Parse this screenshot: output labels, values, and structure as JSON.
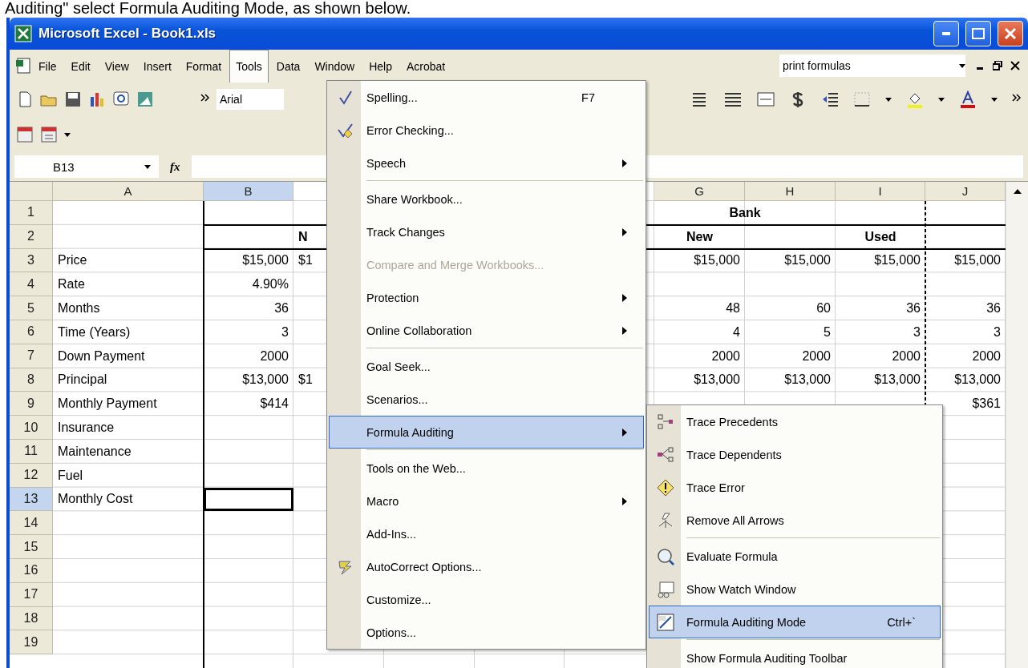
{
  "caption": "Auditing\" select Formula Auditing Mode, as shown below.",
  "window": {
    "title": "Microsoft Excel - Book1.xls"
  },
  "menubar": [
    {
      "label": "File",
      "selected": false
    },
    {
      "label": "Edit",
      "selected": false
    },
    {
      "label": "View",
      "selected": false
    },
    {
      "label": "Insert",
      "selected": false
    },
    {
      "label": "Format",
      "selected": false
    },
    {
      "label": "Tools",
      "selected": true
    },
    {
      "label": "Data",
      "selected": false
    },
    {
      "label": "Window",
      "selected": false
    },
    {
      "label": "Help",
      "selected": false
    },
    {
      "label": "Acrobat",
      "selected": false
    }
  ],
  "help_box": {
    "value": "print formulas"
  },
  "toolbar": {
    "font_field": {
      "value": "Arial"
    }
  },
  "formula_bar": {
    "name_box": "B13",
    "fx_label": "fx"
  },
  "columns": {
    "a": {
      "label": "A",
      "selected": false
    },
    "b": {
      "label": "B",
      "selected": true
    },
    "g": {
      "label": "G",
      "selected": false
    },
    "h": {
      "label": "H",
      "selected": false
    },
    "i": {
      "label": "I",
      "selected": false
    },
    "j": {
      "label": "J",
      "selected": false
    }
  },
  "rows": [
    {
      "header": "1",
      "selected": false,
      "kind": "heading",
      "cells": {
        "g": "Bank"
      }
    },
    {
      "header": "2",
      "selected": false,
      "kind": "heading",
      "cells": {
        "c": "N",
        "g": "New",
        "i": "Used"
      }
    },
    {
      "header": "3",
      "selected": false,
      "kind": "data",
      "cells": {
        "a": "Price",
        "b": "$15,000",
        "c": "$1",
        "g": "$15,000",
        "h": "$15,000",
        "i": "$15,000",
        "j": "$15,000"
      }
    },
    {
      "header": "4",
      "selected": false,
      "kind": "data",
      "cells": {
        "a": "Rate",
        "b": "4.90%"
      }
    },
    {
      "header": "5",
      "selected": false,
      "kind": "data",
      "cells": {
        "a": "Months",
        "b": "36",
        "g": "48",
        "h": "60",
        "i": "36",
        "j": "36"
      }
    },
    {
      "header": "6",
      "selected": false,
      "kind": "data",
      "cells": {
        "a": "Time (Years)",
        "b": "3",
        "g": "4",
        "h": "5",
        "i": "3",
        "j": "3"
      }
    },
    {
      "header": "7",
      "selected": false,
      "kind": "data",
      "cells": {
        "a": "Down Payment",
        "b": "2000",
        "g": "2000",
        "h": "2000",
        "i": "2000",
        "j": "2000"
      }
    },
    {
      "header": "8",
      "selected": false,
      "kind": "data",
      "cells": {
        "a": "Principal",
        "b": "$13,000",
        "c": "$1",
        "g": "$13,000",
        "h": "$13,000",
        "i": "$13,000",
        "j": "$13,000"
      }
    },
    {
      "header": "9",
      "selected": false,
      "kind": "data",
      "cells": {
        "a": "Monthly Payment",
        "b": "$414",
        "j": "$361"
      }
    },
    {
      "header": "10",
      "selected": false,
      "kind": "data",
      "cells": {
        "a": "Insurance"
      }
    },
    {
      "header": "11",
      "selected": false,
      "kind": "data",
      "cells": {
        "a": "Maintenance"
      }
    },
    {
      "header": "12",
      "selected": false,
      "kind": "data",
      "cells": {
        "a": "Fuel"
      }
    },
    {
      "header": "13",
      "selected": true,
      "kind": "data",
      "cells": {
        "a": "Monthly Cost"
      }
    },
    {
      "header": "14",
      "selected": false,
      "kind": "data",
      "cells": {}
    },
    {
      "header": "15",
      "selected": false,
      "kind": "data",
      "cells": {}
    },
    {
      "header": "16",
      "selected": false,
      "kind": "data",
      "cells": {}
    },
    {
      "header": "17",
      "selected": false,
      "kind": "data",
      "cells": {}
    },
    {
      "header": "18",
      "selected": false,
      "kind": "data",
      "cells": {}
    },
    {
      "header": "19",
      "selected": false,
      "kind": "data",
      "cells": {}
    }
  ],
  "tools_menu": [
    {
      "label": "Spelling...",
      "shortcut": "F7",
      "submenu": false,
      "disabled": false,
      "selected": false,
      "separator_before": false
    },
    {
      "label": "Error Checking...",
      "submenu": false,
      "disabled": false,
      "selected": false,
      "separator_before": false
    },
    {
      "label": "Speech",
      "submenu": true,
      "disabled": false,
      "selected": false,
      "separator_before": false
    },
    {
      "label": "Share Workbook...",
      "submenu": false,
      "disabled": false,
      "selected": false,
      "separator_before": true
    },
    {
      "label": "Track Changes",
      "submenu": true,
      "disabled": false,
      "selected": false,
      "separator_before": false
    },
    {
      "label": "Compare and Merge Workbooks...",
      "submenu": false,
      "disabled": true,
      "selected": false,
      "separator_before": false
    },
    {
      "label": "Protection",
      "submenu": true,
      "disabled": false,
      "selected": false,
      "separator_before": false
    },
    {
      "label": "Online Collaboration",
      "submenu": true,
      "disabled": false,
      "selected": false,
      "separator_before": false
    },
    {
      "label": "Goal Seek...",
      "submenu": false,
      "disabled": false,
      "selected": false,
      "separator_before": true
    },
    {
      "label": "Scenarios...",
      "submenu": false,
      "disabled": false,
      "selected": false,
      "separator_before": false
    },
    {
      "label": "Formula Auditing",
      "submenu": true,
      "disabled": false,
      "selected": true,
      "separator_before": false
    },
    {
      "label": "Tools on the Web...",
      "submenu": false,
      "disabled": false,
      "selected": false,
      "separator_before": true
    },
    {
      "label": "Macro",
      "submenu": true,
      "disabled": false,
      "selected": false,
      "separator_before": false
    },
    {
      "label": "Add-Ins...",
      "submenu": false,
      "disabled": false,
      "selected": false,
      "separator_before": false
    },
    {
      "label": "AutoCorrect Options...",
      "submenu": false,
      "disabled": false,
      "selected": false,
      "separator_before": false
    },
    {
      "label": "Customize...",
      "submenu": false,
      "disabled": false,
      "selected": false,
      "separator_before": false
    },
    {
      "label": "Options...",
      "submenu": false,
      "disabled": false,
      "selected": false,
      "separator_before": false
    }
  ],
  "auditing_submenu": [
    {
      "label": "Trace Precedents",
      "selected": false,
      "separator_before": false
    },
    {
      "label": "Trace Dependents",
      "selected": false,
      "separator_before": false
    },
    {
      "label": "Trace Error",
      "selected": false,
      "separator_before": false
    },
    {
      "label": "Remove All Arrows",
      "selected": false,
      "separator_before": false
    },
    {
      "label": "Evaluate Formula",
      "selected": false,
      "separator_before": true
    },
    {
      "label": "Show Watch Window",
      "selected": false,
      "separator_before": false
    },
    {
      "label": "Formula Auditing Mode",
      "shortcut": "Ctrl+`",
      "selected": true,
      "separator_before": false
    },
    {
      "label": "Show Formula Auditing Toolbar",
      "selected": false,
      "separator_before": true
    }
  ]
}
